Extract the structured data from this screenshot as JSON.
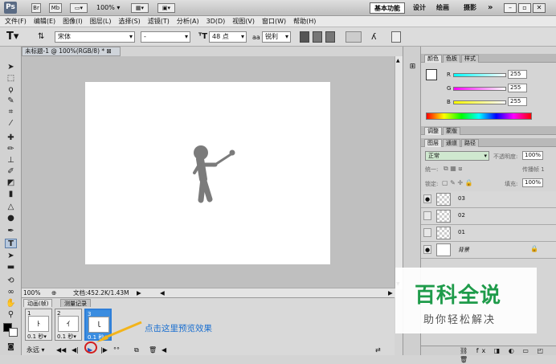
{
  "titlebar": {
    "logo": "Ps",
    "icon_br": "Br",
    "icon_mb": "Mb",
    "zoom": "100%",
    "workspaces": [
      "基本功能",
      "设计",
      "绘画",
      "摄影"
    ],
    "more": "»"
  },
  "menu": [
    "文件(F)",
    "编辑(E)",
    "图像(I)",
    "图层(L)",
    "选择(S)",
    "滤镜(T)",
    "分析(A)",
    "3D(D)",
    "视图(V)",
    "窗口(W)",
    "帮助(H)"
  ],
  "options": {
    "tool_glyph": "T",
    "font_family": "宋体",
    "font_style": "-",
    "font_size": "48 点",
    "aa_label": "aa",
    "aa_mode": "锐利"
  },
  "document": {
    "tab_title": "未标题-1 @ 100%(RGB/8) *",
    "zoom": "100%",
    "doc_size": "文档:452.2K/1.43M"
  },
  "animation": {
    "tabs": [
      "动画(帧)",
      "测量记录"
    ],
    "frames": [
      {
        "num": "1",
        "delay": "0.1 秒▾",
        "glyph": "ﾄ"
      },
      {
        "num": "2",
        "delay": "0.1 秒▾",
        "glyph": "ｲ"
      },
      {
        "num": "3",
        "delay": "0.1 秒",
        "glyph": "ｌ"
      }
    ],
    "loop": "永远",
    "annotation": "点击这里预览效果"
  },
  "color_panel": {
    "tabs": [
      "颜色",
      "色板",
      "样式"
    ],
    "channels": [
      {
        "label": "R",
        "value": "255"
      },
      {
        "label": "G",
        "value": "255"
      },
      {
        "label": "B",
        "value": "255"
      }
    ]
  },
  "adjust_panel": {
    "tabs": [
      "调整",
      "蒙版"
    ]
  },
  "layers_panel": {
    "tabs": [
      "图层",
      "通道",
      "路径"
    ],
    "blend_mode": "正常",
    "opacity_label": "不透明度:",
    "opacity": "100%",
    "unify_label": "统一:",
    "propagate_label": "传播帧 1",
    "lock_label": "锁定:",
    "fill_label": "填充:",
    "fill": "100%",
    "layers": [
      {
        "name": "03",
        "visible": true
      },
      {
        "name": "02",
        "visible": false
      },
      {
        "name": "01",
        "visible": false
      },
      {
        "name": "背景",
        "visible": true
      }
    ]
  },
  "watermark": {
    "title": "百科全说",
    "subtitle": "助你轻松解决"
  }
}
